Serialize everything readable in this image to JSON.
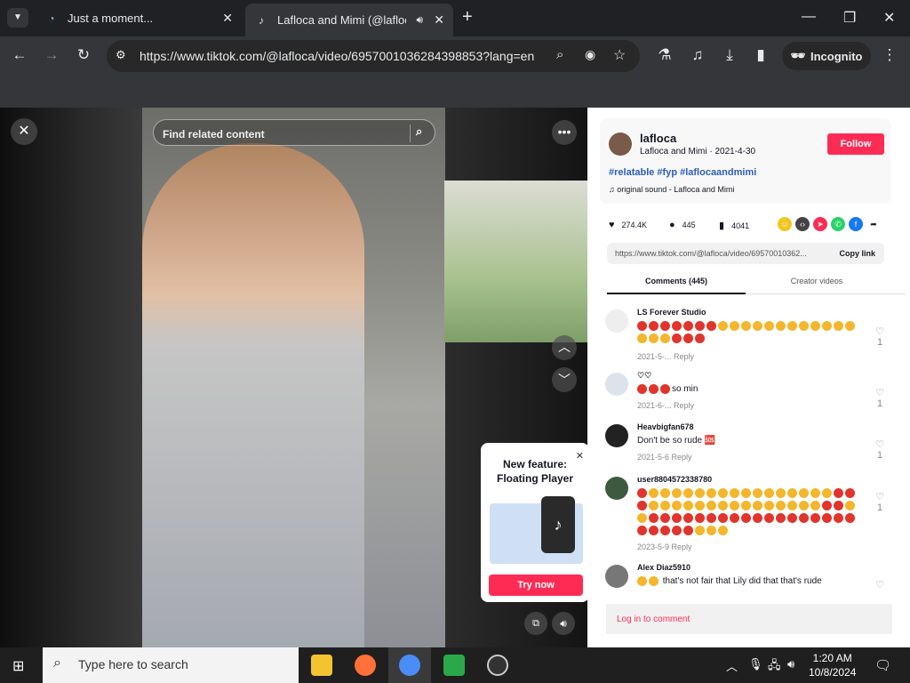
{
  "browser": {
    "tabs": [
      {
        "label": "Just a moment..."
      },
      {
        "label": "Lafloca and Mimi (@lafloc"
      }
    ],
    "url": "https://www.tiktok.com/@lafloca/video/6957001036284398853?lang=en",
    "incognito_label": "Incognito"
  },
  "video": {
    "search_placeholder": "Find related content",
    "popup": {
      "title_line1": "New feature:",
      "title_line2": "Floating Player",
      "button": "Try now"
    }
  },
  "post": {
    "username": "lafloca",
    "nickname_date": "Lafloca and Mimi · 2021-4-30",
    "follow_label": "Follow",
    "hashtags": "#relatable #fyp #laflocaandmimi",
    "sound": "original sound - Lafloca and Mimi",
    "likes": "274.4K",
    "comments_count": "445",
    "saves": "4041",
    "link": "https://www.tiktok.com/@lafloca/video/69570010362...",
    "copy_link": "Copy link",
    "tab_comments": "Comments (445)",
    "tab_creator": "Creator videos"
  },
  "comments": [
    {
      "user": "LS Forever Studio",
      "text": "",
      "meta": "2021-5-...   Reply",
      "likes": "1"
    },
    {
      "user": "♡♡",
      "text": "so min",
      "meta": "2021-6-...   Reply",
      "likes": "1"
    },
    {
      "user": "Heavbigfan678",
      "text": "Don't be so rude 🆘",
      "meta": "2021-5-6   Reply",
      "likes": "1"
    },
    {
      "user": "user8804572338780",
      "text": "",
      "meta": "2023-5-9   Reply",
      "likes": "1"
    },
    {
      "user": "Alex Diaz5910",
      "text": "that's not fair that Lily did that that's rude",
      "meta": "",
      "likes": ""
    }
  ],
  "login_label": "Log in to comment",
  "taskbar": {
    "search_placeholder": "Type here to search",
    "time": "1:20 AM",
    "date": "10/8/2024"
  },
  "colors": {
    "accent": "#fe2c55",
    "link": "#2b5db9"
  }
}
